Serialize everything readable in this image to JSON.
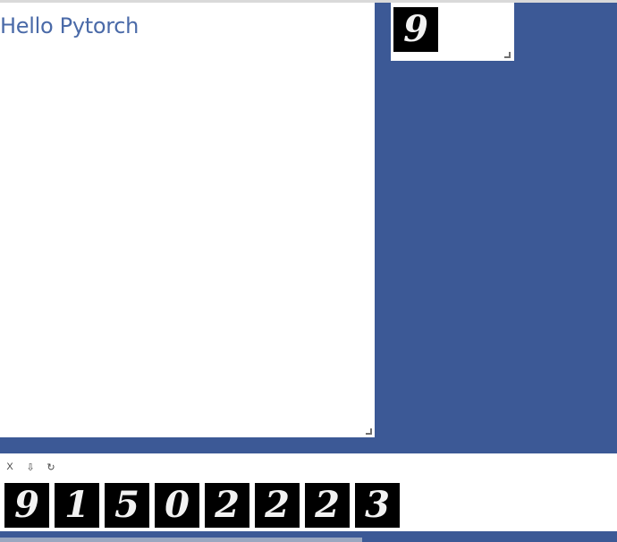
{
  "text_pane": {
    "title": "Hello Pytorch"
  },
  "image_pane": {
    "digit": "9"
  },
  "strip_pane": {
    "toolbar": {
      "close_label": "X",
      "download_label": "⇩",
      "refresh_label": "↻"
    },
    "digits": [
      "9",
      "1",
      "5",
      "0",
      "2",
      "2",
      "2",
      "3"
    ]
  },
  "colors": {
    "background": "#3c5996",
    "title_text": "#4a6aa8",
    "digit_bg": "#000000",
    "digit_fg": "#f2f2f2"
  }
}
